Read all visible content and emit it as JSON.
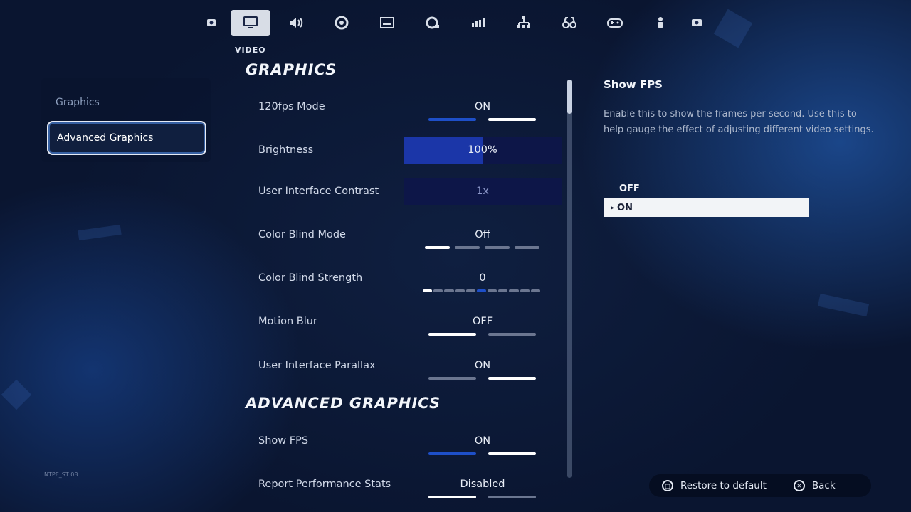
{
  "tabs": [
    {
      "icon": "account-icon",
      "active": false
    },
    {
      "icon": "monitor-icon",
      "active": true
    },
    {
      "icon": "speaker-icon",
      "active": false
    },
    {
      "icon": "gear-icon",
      "active": false
    },
    {
      "icon": "subtitles-icon",
      "active": false
    },
    {
      "icon": "controller-sensitivity-icon",
      "active": false
    },
    {
      "icon": "network-icon",
      "active": false
    },
    {
      "icon": "hierarchy-icon",
      "active": false
    },
    {
      "icon": "binoculars-icon",
      "active": false
    },
    {
      "icon": "gamepad-icon",
      "active": false
    },
    {
      "icon": "person-icon",
      "active": false
    },
    {
      "icon": "screenshot-icon",
      "active": false
    }
  ],
  "section_label": "VIDEO",
  "left_nav": {
    "items": [
      {
        "label": "Graphics"
      },
      {
        "label": "Advanced Graphics"
      }
    ]
  },
  "build_text": "NTPE_ST 08",
  "main": {
    "graphics_heading": "GRAPHICS",
    "advanced_heading": "ADVANCED GRAPHICS",
    "rows": {
      "fps120": {
        "label": "120fps Mode",
        "value": "ON",
        "segments": 2,
        "selected": 1
      },
      "brightness": {
        "label": "Brightness",
        "value": "100%",
        "fill_fraction": 0.5
      },
      "ui_contrast": {
        "label": "User Interface Contrast",
        "value": "1x"
      },
      "color_blind_mode": {
        "label": "Color Blind Mode",
        "value": "Off",
        "segments": 4,
        "selected": 0
      },
      "color_blind_strength": {
        "label": "Color Blind Strength",
        "value": "0",
        "segments": 11,
        "selected": 0
      },
      "motion_blur": {
        "label": "Motion Blur",
        "value": "OFF",
        "segments": 2,
        "selected": 0
      },
      "ui_parallax": {
        "label": "User Interface Parallax",
        "value": "ON",
        "segments": 2,
        "selected": 1
      },
      "show_fps": {
        "label": "Show FPS",
        "value": "ON",
        "segments": 2,
        "selected": 1
      },
      "report_perf": {
        "label": "Report Performance Stats",
        "value": "Disabled",
        "segments": 2,
        "selected": 0
      }
    },
    "scroll_fraction": 0.09
  },
  "right_panel": {
    "title": "Show FPS",
    "description": "Enable this to show the frames per second. Use this to help gauge the effect of adjusting different video settings.",
    "options": [
      {
        "label": "OFF",
        "selected": false
      },
      {
        "label": "ON",
        "selected": true,
        "caret": "▸"
      }
    ]
  },
  "bottom_bar": {
    "restore_label": "Restore to default",
    "back_label": "Back"
  },
  "colors": {
    "accent_blue": "#1e4fc8",
    "segment_inactive": "#6b7690",
    "segment_active": "#ffffff"
  }
}
